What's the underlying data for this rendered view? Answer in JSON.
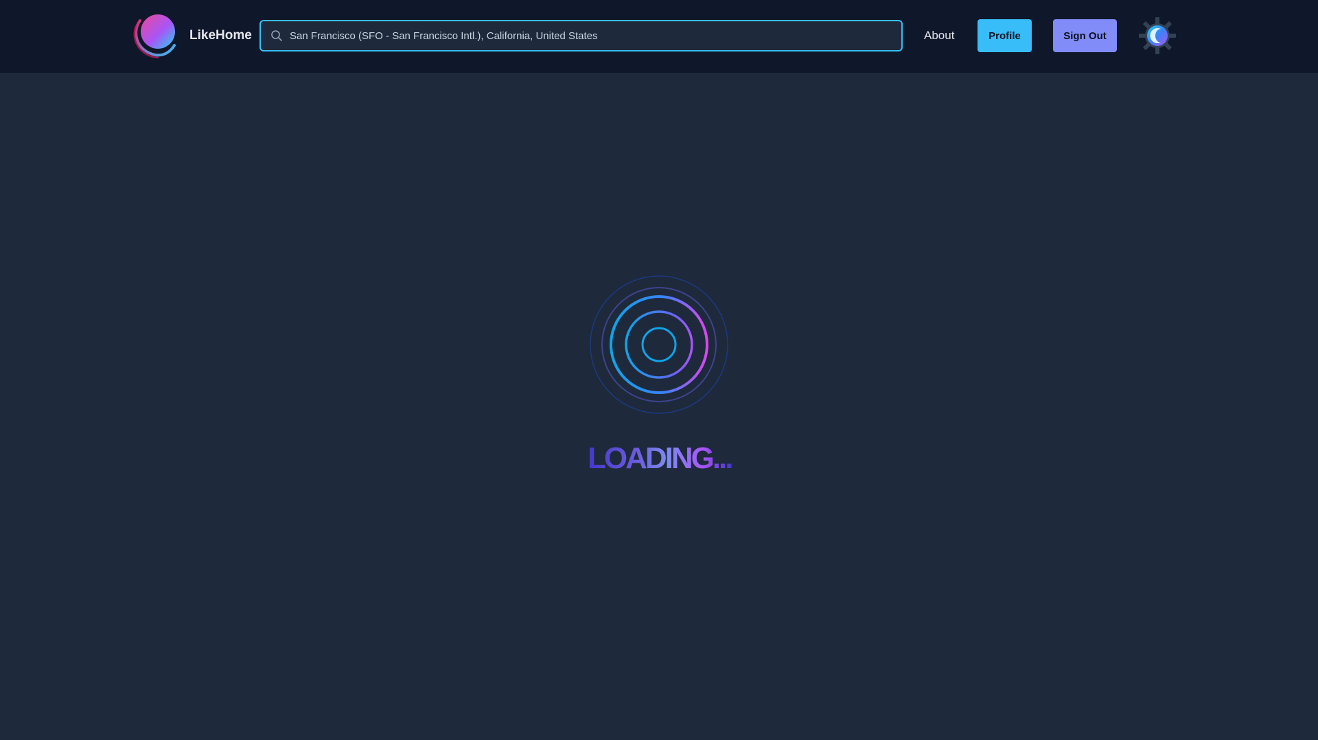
{
  "navbar": {
    "brand": "LikeHome",
    "search": {
      "value": "San Francisco (SFO - San Francisco Intl.), California, United States",
      "placeholder": "",
      "icon": "search-icon"
    },
    "about_label": "About",
    "profile_label": "Profile",
    "signout_label": "Sign Out",
    "settings_icon": "gear-icon"
  },
  "main": {
    "loading_text": "LOADING..."
  },
  "colors": {
    "nav_bg": "#0f172a",
    "page_bg": "#1e293b",
    "accent_cyan": "#38bdf8",
    "accent_indigo": "#818cf8",
    "accent_magenta": "#d946ef"
  }
}
